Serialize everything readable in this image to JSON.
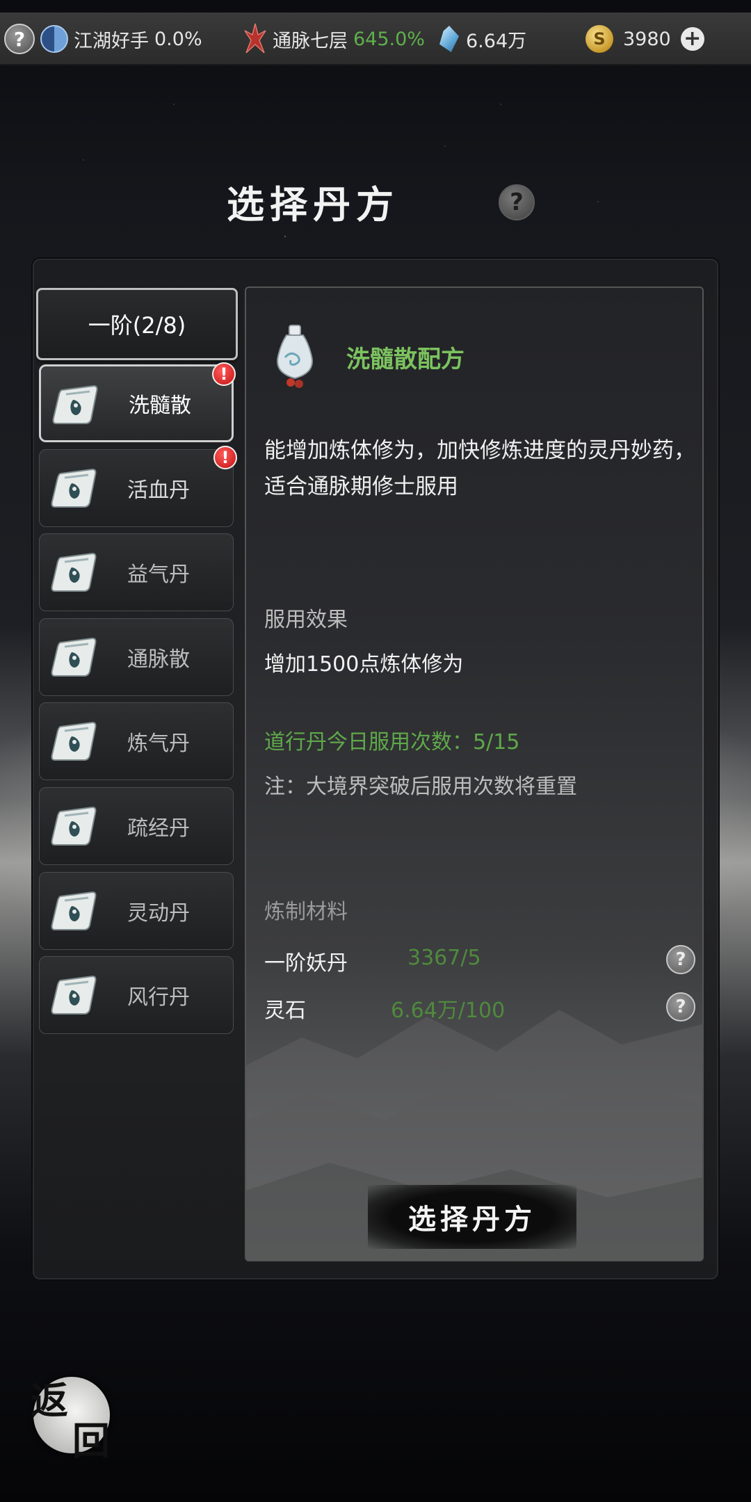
{
  "topbar": {
    "help_glyph": "?",
    "rank_label": "江湖好手",
    "rank_percent": "0.0%",
    "realm_label": "通脉七层",
    "realm_percent": "645.0%",
    "spirit_stone": "6.64万",
    "coins": "3980",
    "plus_glyph": "+",
    "icons": [
      "help-icon",
      "taiji-icon",
      "realm-icon",
      "crystal-icon",
      "coin-icon",
      "plus-icon"
    ]
  },
  "page": {
    "title": "选择丹方",
    "help_glyph": "?"
  },
  "tier": {
    "label": "一阶(2/8)"
  },
  "recipes": [
    {
      "name": "洗髓散",
      "selected": true,
      "alert": true
    },
    {
      "name": "活血丹",
      "selected": false,
      "alert": true
    },
    {
      "name": "益气丹",
      "selected": false,
      "alert": false
    },
    {
      "name": "通脉散",
      "selected": false,
      "alert": false
    },
    {
      "name": "炼气丹",
      "selected": false,
      "alert": false
    },
    {
      "name": "疏经丹",
      "selected": false,
      "alert": false
    },
    {
      "name": "灵动丹",
      "selected": false,
      "alert": false
    },
    {
      "name": "风行丹",
      "selected": false,
      "alert": false
    }
  ],
  "alert_glyph": "!",
  "detail": {
    "title": "洗髓散配方",
    "description": "能增加炼体修为，加快修炼进度的灵丹妙药，适合通脉期修士服用",
    "effect_heading": "服用效果",
    "effect_text": "增加1500点炼体修为",
    "daily_uses": "道行丹今日服用次数：5/15",
    "note": "注：大境界突破后服用次数将重置",
    "materials_heading": "炼制材料",
    "materials": [
      {
        "name": "一阶妖丹",
        "value": "3367/5"
      },
      {
        "name": "灵石",
        "value": "6.64万/100"
      }
    ],
    "material_help_glyph": "?",
    "select_button": "选择丹方"
  },
  "back": {
    "char1": "返",
    "char2": "回"
  },
  "colors": {
    "accent_green": "#7cc35f",
    "value_green": "#5fa94a",
    "alert_red": "#d41b1b"
  }
}
